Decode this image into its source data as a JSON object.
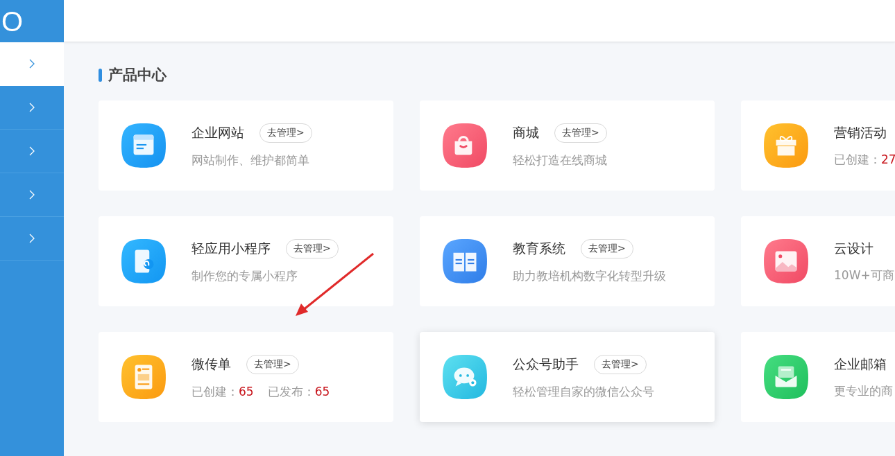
{
  "logo": {
    "text": "O"
  },
  "sidebar": {
    "items": [
      {
        "selected": true
      },
      {
        "selected": false
      },
      {
        "selected": false
      },
      {
        "selected": false
      },
      {
        "selected": false
      }
    ]
  },
  "section": {
    "title": "产品中心"
  },
  "cards": [
    {
      "title": "企业网站",
      "button": "去管理>",
      "description": "网站制作、维护都简单",
      "hovered": false
    },
    {
      "title": "商城",
      "button": "去管理>",
      "description": "轻松打造在线商城",
      "hovered": false
    },
    {
      "title": "营销活动",
      "stats": [
        {
          "label": "已创建：",
          "value": "27"
        }
      ],
      "hovered": false
    },
    {
      "title": "轻应用小程序",
      "button": "去管理>",
      "description": "制作您的专属小程序",
      "hovered": false
    },
    {
      "title": "教育系统",
      "button": "去管理>",
      "description": "助力教培机构数字化转型升级",
      "hovered": false
    },
    {
      "title": "云设计",
      "description": "10W+可商",
      "hovered": false
    },
    {
      "title": "微传单",
      "button": "去管理>",
      "stats": [
        {
          "label": "已创建：",
          "value": "65"
        },
        {
          "label": "已发布：",
          "value": "65"
        }
      ],
      "hovered": false
    },
    {
      "title": "公众号助手",
      "button": "去管理>",
      "description": "轻松管理自家的微信公众号",
      "hovered": true
    },
    {
      "title": "企业邮箱",
      "description": "更专业的商",
      "hovered": false
    }
  ]
}
